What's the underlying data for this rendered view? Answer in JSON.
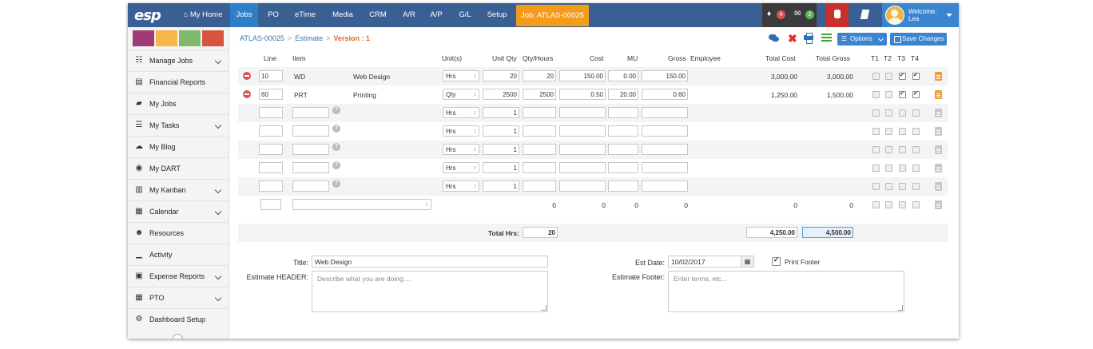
{
  "nav": {
    "logo": "esp",
    "home": "My Home",
    "items": [
      "Jobs",
      "PO",
      "eTime",
      "Media",
      "CRM",
      "A/R",
      "A/P",
      "G/L",
      "Setup"
    ],
    "job_button": "Job: ATLAS-00025",
    "notifications_count": "4",
    "messages_count": "2",
    "welcome_line1": "Welcome,",
    "welcome_line2": "Lea"
  },
  "sidebar": {
    "swatch_colors": [
      "#a23a78",
      "#f8b64a",
      "#7fb96b",
      "#d9533f"
    ],
    "items": [
      {
        "label": "Manage Jobs",
        "icon": "sitemap-icon",
        "glyph": "☷",
        "chevron": true
      },
      {
        "label": "Financial Reports",
        "icon": "report-icon",
        "glyph": "▤",
        "chevron": false
      },
      {
        "label": "My Jobs",
        "icon": "folder-icon",
        "glyph": "▰",
        "chevron": false
      },
      {
        "label": "My Tasks",
        "icon": "tasks-icon",
        "glyph": "☰",
        "chevron": true
      },
      {
        "label": "My Blog",
        "icon": "comments-icon",
        "glyph": "☁",
        "chevron": false
      },
      {
        "label": "My DART",
        "icon": "dart-icon",
        "glyph": "◉",
        "chevron": false
      },
      {
        "label": "My Kanban",
        "icon": "map-icon",
        "glyph": "▥",
        "chevron": true
      },
      {
        "label": "Calendar",
        "icon": "calendar-icon",
        "glyph": "▦",
        "chevron": true
      },
      {
        "label": "Resources",
        "icon": "users-icon",
        "glyph": "☻",
        "chevron": false
      },
      {
        "label": "Activity",
        "icon": "bar-chart-icon",
        "glyph": "▁",
        "chevron": false
      },
      {
        "label": "Expense Reports",
        "icon": "money-icon",
        "glyph": "▣",
        "chevron": true
      },
      {
        "label": "PTO",
        "icon": "calendar-grid-icon",
        "glyph": "▦",
        "chevron": true
      },
      {
        "label": "Dashboard Setup",
        "icon": "gears-icon",
        "glyph": "⚙",
        "chevron": false
      }
    ]
  },
  "breadcrumb": {
    "job": "ATLAS-00025",
    "section": "Estimate",
    "version": "Version : 1"
  },
  "toolbar": {
    "options_label": "Options",
    "save_label": "Save Changes"
  },
  "columns": [
    "Line",
    "Item",
    "Unit(s)",
    "Unit Qty",
    "Qty/Hours",
    "Cost",
    "MU",
    "Gross",
    "Employee",
    "Total Cost",
    "Total Gross",
    "T1",
    "T2",
    "T3",
    "T4"
  ],
  "rows": [
    {
      "line": "10",
      "item": "WD",
      "desc": "Web Design",
      "unit": "Hrs",
      "unit_qty": "20",
      "qty": "20",
      "cost": "150.00",
      "mu": "0.00",
      "gross": "150.00",
      "total_cost": "3,000.00",
      "total_gross": "3,000.00",
      "t3": true,
      "t4": true
    },
    {
      "line": "60",
      "item": "PRT",
      "desc": "Printing",
      "unit": "Qty",
      "unit_qty": "2500",
      "qty": "2500",
      "cost": "0.50",
      "mu": "20.00",
      "gross": "0.60",
      "total_cost": "1,250.00",
      "total_gross": "1,500.00",
      "t3": true,
      "t4": true
    }
  ],
  "empty_rows": {
    "unit": "Hrs",
    "unit_qty": "1"
  },
  "summary_row": {
    "qty": "0",
    "cost": "0",
    "mu": "0",
    "gross": "0",
    "total_cost": "0",
    "total_gross": "0"
  },
  "totals": {
    "total_hrs_label": "Total Hrs:",
    "total_hrs": "20",
    "total_cost": "4,250.00",
    "total_gross": "4,500.00"
  },
  "form": {
    "title_label": "Title:",
    "title_value": "Web Design",
    "header_label": "Estimate HEADER:",
    "header_placeholder": "Describe what you are doing....",
    "est_date_label": "Est Date:",
    "est_date_value": "10/02/2017",
    "print_footer_label": "Print Footer",
    "footer_label": "Estimate Footer:",
    "footer_placeholder": "Enter terms, etc..."
  }
}
